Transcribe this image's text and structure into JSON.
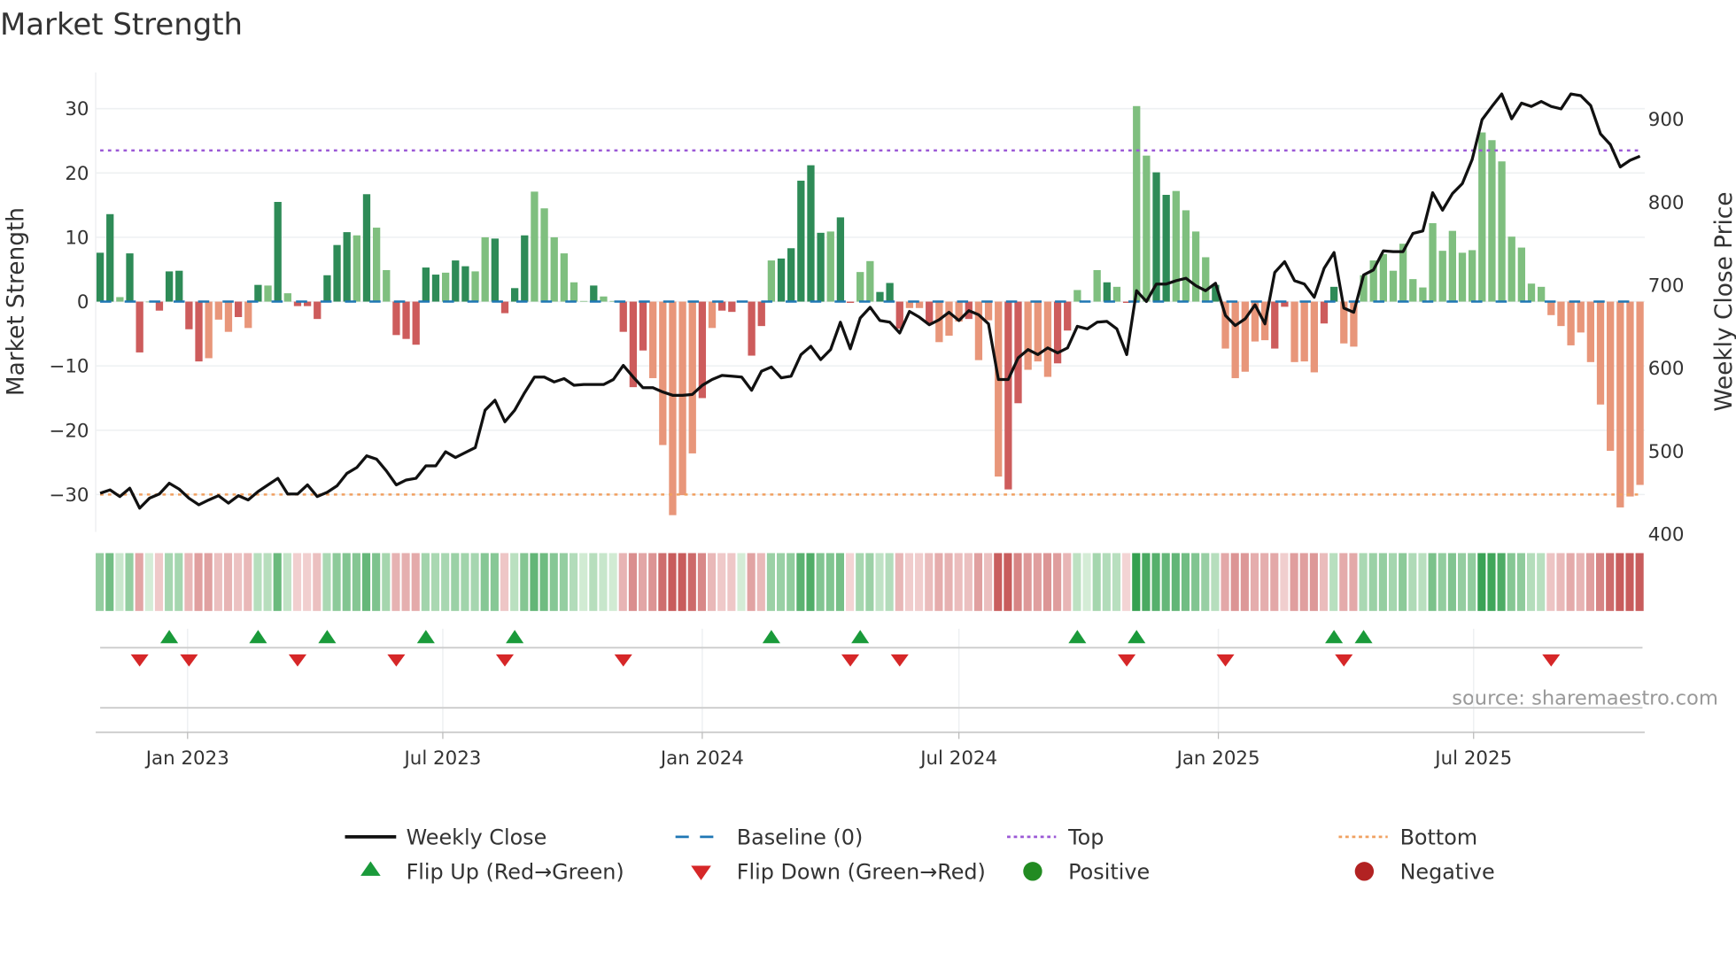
{
  "chart_data": {
    "type": "bar",
    "title": "Market Strength",
    "ylabel": "Market Strength",
    "y2label": "Weekly Close Price",
    "source": "source: sharemaestro.com",
    "start_date": "2022-10-31",
    "interval_days": 7,
    "ylim": [
      -35.8,
      35.6
    ],
    "y2lim": [
      400,
      955
    ],
    "yticks": [
      "30",
      "20",
      "10",
      "0",
      "−10",
      "−20",
      "−30"
    ],
    "ytick_values": [
      30,
      20,
      10,
      0,
      -10,
      -20,
      -30
    ],
    "y2ticks": [
      "900",
      "800",
      "700",
      "600",
      "500",
      "400"
    ],
    "y2tick_values": [
      900,
      800,
      700,
      600,
      500,
      400
    ],
    "xticks": [
      {
        "label": "Jan 2023",
        "date": "2023-01-01"
      },
      {
        "label": "Jul 2023",
        "date": "2023-07-01"
      },
      {
        "label": "Jan 2024",
        "date": "2024-01-01"
      },
      {
        "label": "Jul 2024",
        "date": "2024-07-01"
      },
      {
        "label": "Jan 2025",
        "date": "2025-01-01"
      },
      {
        "label": "Jul 2025",
        "date": "2025-07-01"
      }
    ],
    "top_level": 23.5,
    "bottom_level": -30,
    "baseline": 0,
    "strength": [
      7.6,
      13.6,
      0.7,
      7.5,
      -7.9,
      0,
      -1.4,
      4.7,
      4.8,
      -4.3,
      -9.3,
      -8.8,
      -2.8,
      -4.7,
      -2.4,
      -4.1,
      2.6,
      2.5,
      15.5,
      1.3,
      -0.7,
      -0.7,
      -2.7,
      4.1,
      8.8,
      10.8,
      10.3,
      16.7,
      11.5,
      4.9,
      -5.2,
      -5.8,
      -6.7,
      5.3,
      4.2,
      4.5,
      6.4,
      5.5,
      4.7,
      10.0,
      9.8,
      -1.8,
      2.1,
      10.3,
      17.1,
      14.5,
      10.0,
      7.5,
      3.0,
      0.1,
      2.5,
      0.8,
      0.1,
      -4.7,
      -13.3,
      -7.6,
      -11.9,
      -22.3,
      -33.2,
      -30.1,
      -23.6,
      -15.0,
      -4.1,
      -1.4,
      -1.6,
      0,
      -8.4,
      -3.8,
      6.4,
      6.7,
      8.3,
      18.8,
      21.2,
      10.7,
      10.9,
      13.1,
      -0.2,
      4.6,
      6.3,
      1.5,
      2.9,
      -4.2,
      -1.0,
      -1.0,
      -3.4,
      -6.3,
      -5.3,
      -3.1,
      -2.7,
      -9.1,
      -2.9,
      -27.2,
      -29.2,
      -15.8,
      -10.6,
      -9.3,
      -11.7,
      -9.6,
      -4.5,
      1.8,
      0,
      4.9,
      3.0,
      2.3,
      -0.2,
      30.4,
      22.7,
      20.1,
      16.6,
      17.2,
      14.2,
      10.9,
      6.9,
      2.6,
      -7.3,
      -11.9,
      -10.9,
      -6.2,
      -6.0,
      -7.3,
      -0.8,
      -9.4,
      -9.3,
      -11.0,
      -3.4,
      2.3,
      -6.5,
      -7.0,
      4.1,
      6.4,
      7.4,
      4.8,
      9.0,
      3.5,
      2.2,
      12.2,
      7.9,
      11.0,
      7.6,
      8.0,
      26.3,
      25.1,
      21.8,
      10.1,
      8.4,
      2.8,
      2.3,
      -2.1,
      -3.8,
      -6.8,
      -4.8,
      -9.4,
      -16.0,
      -23.2,
      -32.0,
      -30.3,
      -28.5
    ],
    "bar_shade_seq": "ddlddldddddllldldldlddddddldlldddddlddllddddlllllldlldddllllldldddddldddddlddlldddlldllldlllddlllddllldldllddlllldlllllddlllddl",
    "weekly_close": [
      448,
      452,
      444,
      454,
      430,
      442,
      447,
      460,
      453,
      442,
      434,
      440,
      445,
      436,
      445,
      440,
      450,
      458,
      466,
      447,
      447,
      458,
      444,
      449,
      457,
      472,
      479,
      493,
      489,
      475,
      458,
      464,
      466,
      481,
      481,
      498,
      491,
      497,
      503,
      548,
      560,
      534,
      548,
      569,
      588,
      588,
      582,
      586,
      578,
      579,
      579,
      579,
      585,
      602,
      588,
      575,
      575,
      570,
      566,
      566,
      567,
      578,
      585,
      590,
      589,
      588,
      572,
      595,
      600,
      587,
      589,
      615,
      625,
      609,
      621,
      654,
      622,
      659,
      672,
      656,
      654,
      641,
      667,
      660,
      651,
      657,
      666,
      656,
      668,
      663,
      652,
      585,
      585,
      611,
      621,
      615,
      623,
      617,
      623,
      649,
      646,
      654,
      655,
      646,
      615,
      692,
      679,
      700,
      700,
      704,
      707,
      698,
      692,
      701,
      662,
      650,
      658,
      675,
      652,
      714,
      727,
      704,
      700,
      684,
      719,
      738,
      671,
      666,
      711,
      717,
      740,
      739,
      739,
      761,
      764,
      810,
      789,
      809,
      821,
      850,
      898,
      914,
      929,
      899,
      918,
      914,
      920,
      914,
      911,
      929,
      927,
      915,
      881,
      868,
      841,
      849,
      854
    ],
    "flip_up_weeks": [
      7,
      16,
      23,
      33,
      42,
      68,
      77,
      99,
      105,
      125,
      128
    ],
    "flip_down_weeks": [
      4,
      9,
      20,
      30,
      41,
      53,
      76,
      81,
      104,
      114,
      126,
      147
    ],
    "colors": {
      "strong_pos": "#2e8b57",
      "weak_pos": "#7fbf7f",
      "strong_neg": "#cd5c5c",
      "weak_neg": "#e8967a",
      "line": "#111111",
      "baseline": "#1f77b4",
      "top": "#9b59d6",
      "bottom": "#f0a060",
      "flip_up": "#1a9a3a",
      "flip_down": "#d62728",
      "positive": "#228b22",
      "negative": "#b22222"
    },
    "legend": [
      {
        "label": "Weekly Close",
        "kind": "line"
      },
      {
        "label": "Baseline (0)",
        "kind": "baseline"
      },
      {
        "label": "Top",
        "kind": "top"
      },
      {
        "label": "Bottom",
        "kind": "bottom"
      },
      {
        "label": "Flip Up (Red→Green)",
        "kind": "flip_up"
      },
      {
        "label": "Flip Down (Green→Red)",
        "kind": "flip_down"
      },
      {
        "label": "Positive",
        "kind": "positive"
      },
      {
        "label": "Negative",
        "kind": "negative"
      }
    ],
    "legend_position": "bottom"
  }
}
